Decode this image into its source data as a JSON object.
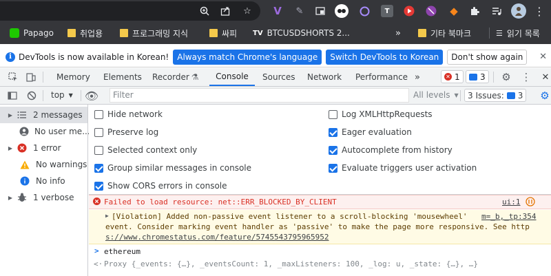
{
  "bookmarks": {
    "items": [
      {
        "label": "Papago"
      },
      {
        "label": "취업용"
      },
      {
        "label": "프로그래밍 지식"
      },
      {
        "label": "싸피"
      },
      {
        "label": "BTCUSDSHORTS 2..."
      }
    ],
    "overflow": "»",
    "other_label": "기타 북마크",
    "reading_list": "읽기 목록"
  },
  "infobar": {
    "message": "DevTools is now available in Korean!",
    "match_button": "Always match Chrome's language",
    "switch_button": "Switch DevTools to Korean",
    "dismiss_button": "Don't show again"
  },
  "devtools": {
    "tabs": [
      "Memory",
      "Elements",
      "Recorder",
      "Console",
      "Sources",
      "Network",
      "Performance"
    ],
    "active_tab": "Console",
    "more_tabs": "»",
    "error_count": "1",
    "message_count": "3"
  },
  "console_toolbar": {
    "context": "top",
    "filter_placeholder": "Filter",
    "levels": "All levels",
    "issues_label": "3 Issues:",
    "issues_count": "3"
  },
  "sidebar": {
    "items": [
      {
        "label": "2 messages"
      },
      {
        "label": "No user me..."
      },
      {
        "label": "1 error"
      },
      {
        "label": "No warnings"
      },
      {
        "label": "No info"
      },
      {
        "label": "1 verbose"
      }
    ]
  },
  "settings": {
    "left": [
      {
        "label": "Hide network",
        "checked": false
      },
      {
        "label": "Preserve log",
        "checked": false
      },
      {
        "label": "Selected context only",
        "checked": false
      },
      {
        "label": "Group similar messages in console",
        "checked": true
      },
      {
        "label": "Show CORS errors in console",
        "checked": true
      }
    ],
    "right": [
      {
        "label": "Log XMLHttpRequests",
        "checked": false
      },
      {
        "label": "Eager evaluation",
        "checked": true
      },
      {
        "label": "Autocomplete from history",
        "checked": true
      },
      {
        "label": "Evaluate triggers user activation",
        "checked": true
      }
    ]
  },
  "messages": {
    "error_text": "Failed to load resource: net::ERR_BLOCKED_BY_CLIENT",
    "error_source": "ui:1",
    "violation_line1": "[Violation] Added non-passive event listener to a scroll-blocking 'mousewheel'",
    "violation_source": "m=_b,_tp:354",
    "violation_line2": "event. Consider marking event handler as 'passive' to make the page more responsive. See http",
    "violation_line3": "s://www.chromestatus.com/feature/5745543795965952",
    "input": "ethereum",
    "output": "Proxy {_events: {…}, _eventsCount: 1, _maxListeners: 100, _log: u, _state: {…}, …}"
  }
}
